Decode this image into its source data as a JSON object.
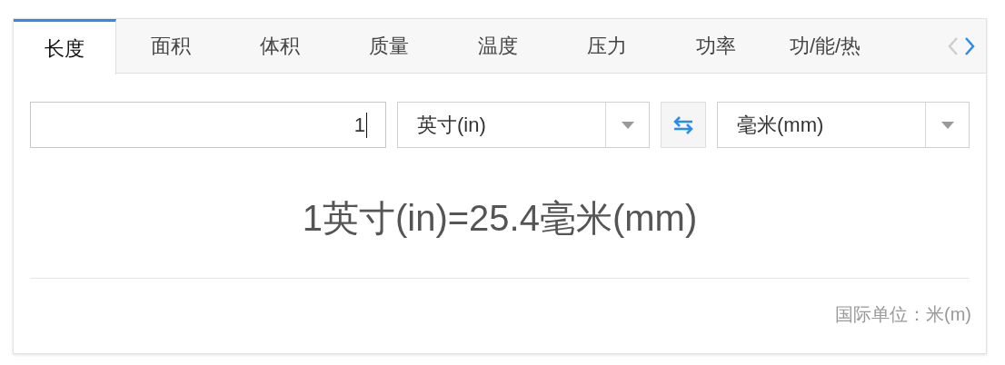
{
  "tabs": [
    {
      "label": "长度",
      "selected": true
    },
    {
      "label": "面积",
      "selected": false
    },
    {
      "label": "体积",
      "selected": false
    },
    {
      "label": "质量",
      "selected": false
    },
    {
      "label": "温度",
      "selected": false
    },
    {
      "label": "压力",
      "selected": false
    },
    {
      "label": "功率",
      "selected": false
    },
    {
      "label": "功/能/热",
      "selected": false
    }
  ],
  "tab_scroll": {
    "prev_disabled": true,
    "next_disabled": false
  },
  "converter": {
    "value": "1",
    "from_unit": "英寸(in)",
    "to_unit": "毫米(mm)"
  },
  "result": "1英寸(in)=25.4毫米(mm)",
  "footer": "国际单位：米(m)"
}
